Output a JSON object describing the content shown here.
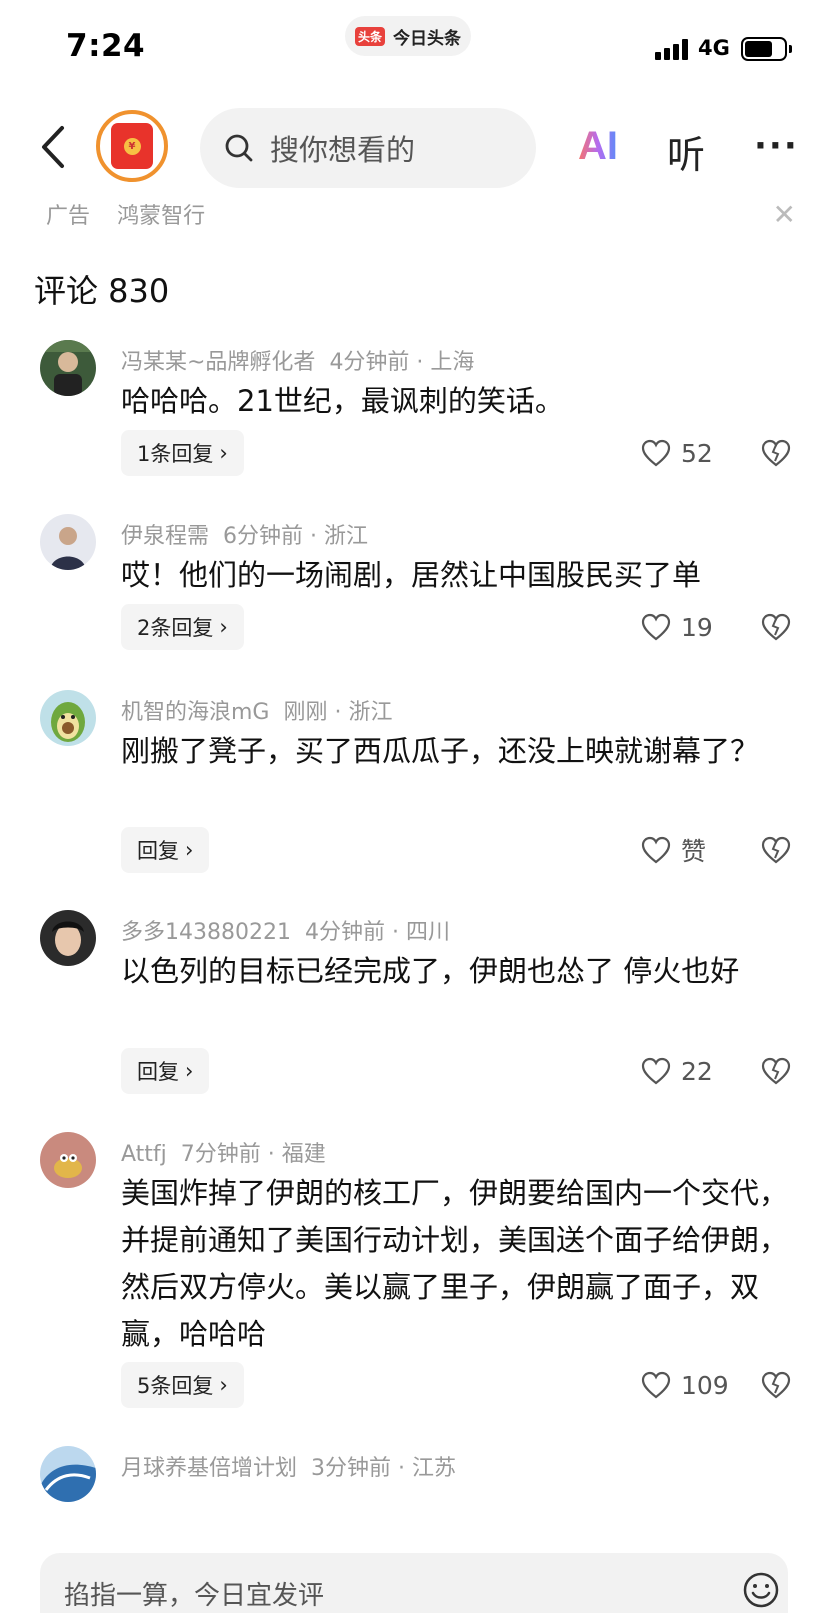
{
  "status": {
    "time": "7:24",
    "app_logo": "头条",
    "app_name": "今日头条",
    "network": "4G"
  },
  "nav": {
    "search_placeholder": "搜你想看的",
    "ai_label": "AI",
    "listen_label": "听",
    "more_label": "···"
  },
  "ad": {
    "label": "广告",
    "name": "鸿蒙智行"
  },
  "comments_header": {
    "label": "评论 830"
  },
  "comments": [
    {
      "user": "冯某某~品牌孵化者",
      "time": "4分钟前 · 上海",
      "text": "哈哈哈。21世纪，最讽刺的笑话。",
      "reply": "1条回复",
      "likes": "52"
    },
    {
      "user": "伊泉程需",
      "time": "6分钟前 · 浙江",
      "text": "哎！他们的一场闹剧，居然让中国股民买了单",
      "reply": "2条回复",
      "likes": "19"
    },
    {
      "user": "机智的海浪mG",
      "time": "刚刚 · 浙江",
      "text": "刚搬了凳子，买了西瓜瓜子，还没上映就谢幕了？",
      "reply": "回复",
      "likes": "赞"
    },
    {
      "user": "多多143880221",
      "time": "4分钟前 · 四川",
      "text": "以色列的目标已经完成了，伊朗也怂了 停火也好",
      "reply": "回复",
      "likes": "22"
    },
    {
      "user": "Attfj",
      "time": "7分钟前 · 福建",
      "text": "美国炸掉了伊朗的核工厂，伊朗要给国内一个交代，并提前通知了美国行动计划，美国送个面子给伊朗，然后双方停火。美以赢了里子，伊朗赢了面子，双赢，哈哈哈",
      "reply": "5条回复",
      "likes": "109"
    },
    {
      "user": "月球养基倍增计划",
      "time": "3分钟前 · 江苏"
    }
  ],
  "bottom": {
    "input_placeholder": "掐指一算，今日宜发评"
  }
}
